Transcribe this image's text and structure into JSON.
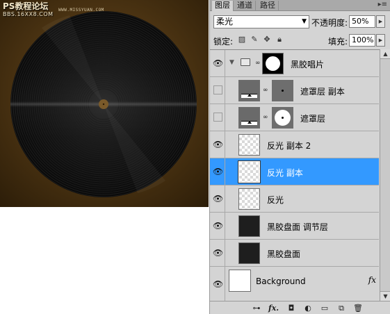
{
  "canvas": {
    "watermark_line1": "PS教程论坛",
    "watermark_line2": "BBS.16XX8.COM",
    "watermark_right": "WWW.MISSYUAN.COM"
  },
  "panel": {
    "tabs": [
      {
        "label": "图层",
        "active": true
      },
      {
        "label": "通道",
        "active": false
      },
      {
        "label": "路径",
        "active": false
      }
    ],
    "menu_icon": "panel-menu-icon",
    "blend_mode": "柔光",
    "opacity_label": "不透明度:",
    "opacity_value": "50%",
    "lock_label": "锁定:",
    "fill_label": "填充:",
    "fill_value": "100%"
  },
  "layers": [
    {
      "name": "黑胶唱片",
      "kind": "group",
      "visible": true,
      "expanded": true
    },
    {
      "name": "遮罩层 副本",
      "kind": "adjustment-with-mask",
      "visible": false
    },
    {
      "name": "遮罩层",
      "kind": "adjustment-with-mask",
      "visible": false
    },
    {
      "name": "反光 副本 2",
      "kind": "transparent",
      "visible": true
    },
    {
      "name": "反光 副本",
      "kind": "transparent",
      "visible": true,
      "selected": true
    },
    {
      "name": "反光",
      "kind": "transparent",
      "visible": true
    },
    {
      "name": "黑胶盘面 调节层",
      "kind": "dark",
      "visible": true
    },
    {
      "name": "黑胶盘面",
      "kind": "dark",
      "visible": true
    },
    {
      "name": "Background",
      "kind": "white",
      "visible": true,
      "fx": "fx"
    }
  ],
  "footer_icons": [
    "link-layers-icon",
    "layer-style-icon",
    "add-mask-icon",
    "adjustment-layer-icon",
    "new-group-icon",
    "new-layer-icon",
    "delete-layer-icon"
  ],
  "colors": {
    "selection": "#3399ff",
    "panel_bg": "#d4d4d4",
    "canvas_brown": "#503714"
  }
}
